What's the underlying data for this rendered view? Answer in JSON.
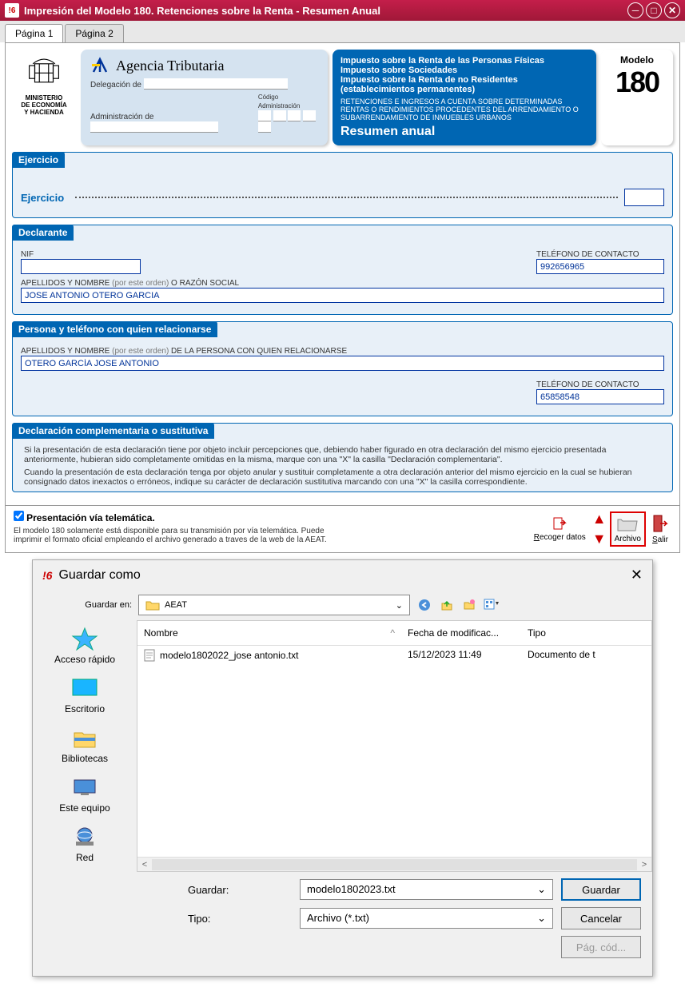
{
  "window": {
    "title": "Impresión del Modelo 180. Retenciones sobre la Renta - Resumen Anual"
  },
  "tabs": {
    "p1": "Página 1",
    "p2": "Página 2"
  },
  "ministry": {
    "line1": "MINISTERIO",
    "line2": "DE ECONOMÍA",
    "line3": "Y HACIENDA"
  },
  "agency": {
    "title": "Agencia Tributaria",
    "delegacion": "Delegación de",
    "admin": "Administración de",
    "codigo": "Código Administración"
  },
  "taxbox": {
    "l1": "Impuesto sobre la Renta de las Personas Físicas",
    "l2": "Impuesto sobre Sociedades",
    "l3": "Impuesto sobre la Renta de no Residentes (establecimientos permanentes)",
    "sub": "RETENCIONES E INGRESOS A CUENTA SOBRE DETERMINADAS RENTAS O RENDIMIENTOS PROCEDENTES DEL ARRENDAMIENTO O SUBARRENDAMIENTO DE INMUEBLES URBANOS",
    "summary": "Resumen anual"
  },
  "model": {
    "label": "Modelo",
    "number": "180"
  },
  "sections": {
    "ejercicio": {
      "title": "Ejercicio",
      "label": "Ejercicio"
    },
    "declarante": {
      "title": "Declarante",
      "nif_label": "NIF",
      "tel_label": "TELÉFONO DE CONTACTO",
      "tel_value": "992656965",
      "name_label": "APELLIDOS Y NOMBRE (por este orden) O RAZÓN SOCIAL",
      "name_value": "JOSE ANTONIO OTERO GARCIA"
    },
    "persona": {
      "title": "Persona y teléfono con quien relacionarse",
      "name_label": "APELLIDOS Y NOMBRE (por este orden) DE LA PERSONA CON QUIEN RELACIONARSE",
      "name_value": "OTERO GARCÍA JOSE ANTONIO",
      "tel_label": "TELÉFONO DE CONTACTO",
      "tel_value": "65858548"
    },
    "comp": {
      "title": "Declaración complementaria o sustitutiva",
      "p1": "Si la presentación de esta declaración tiene por objeto incluir percepciones que, debiendo haber figurado en otra declaración del mismo ejercicio presentada anteriormente, hubieran sido completamente omitidas en la misma, marque con una \"X\" la casilla \"Declaración complementaria\".",
      "p2": "Cuando la presentación de esta declaración tenga por objeto anular y sustituir completamente a otra declaración anterior del mismo ejercicio en la cual se hubieran consignado datos inexactos o erróneos, indique su carácter de declaración sustitutiva marcando con una \"X\" la casilla correspondiente."
    }
  },
  "footer": {
    "check_label": "Presentación vía telemática.",
    "sub": "El modelo 180 solamente está disponible para su transmisión por vía telemática. Puede imprimir el formato oficial empleando el archivo generado a traves de la web de la AEAT.",
    "recoger": "Recoger datos",
    "archivo": "Archivo",
    "salir": "Salir"
  },
  "dialog": {
    "title": "Guardar como",
    "save_in": "Guardar en:",
    "folder": "AEAT",
    "cols": {
      "name": "Nombre",
      "date": "Fecha de modificac...",
      "type": "Tipo"
    },
    "file": {
      "name": "modelo1802022_jose antonio.txt",
      "date": "15/12/2023 11:49",
      "type": "Documento de t"
    },
    "places": {
      "quick": "Acceso rápido",
      "desktop": "Escritorio",
      "libs": "Bibliotecas",
      "pc": "Este equipo",
      "net": "Red"
    },
    "save_label": "Guardar:",
    "filename": "modelo1802023.txt",
    "type_label": "Tipo:",
    "type_value": "Archivo (*.txt)",
    "btn_save": "Guardar",
    "btn_cancel": "Cancelar",
    "btn_code": "Pág. cód..."
  }
}
